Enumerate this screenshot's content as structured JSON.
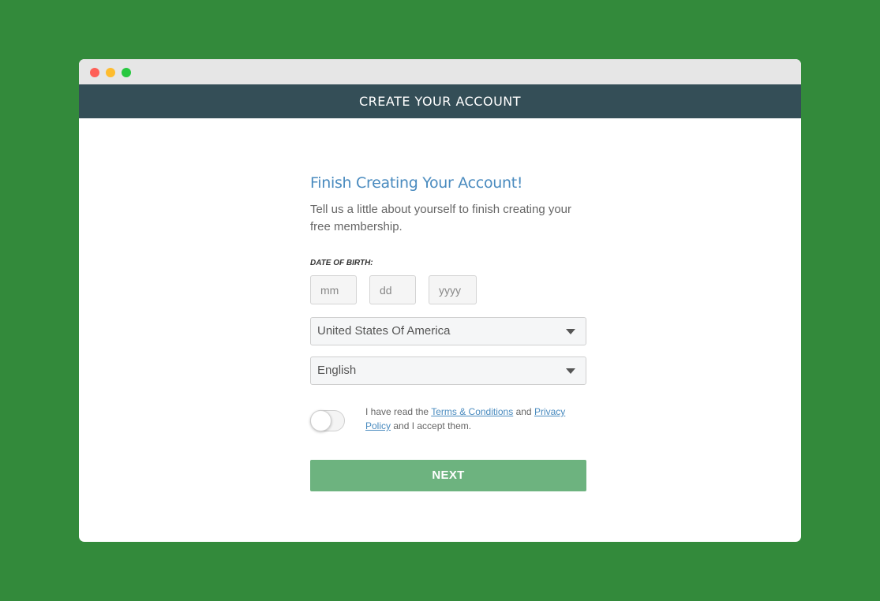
{
  "window": {
    "header_title": "CREATE YOUR ACCOUNT"
  },
  "form": {
    "headline": "Finish Creating Your Account!",
    "subtitle": "Tell us a little about yourself to finish creating your free membership.",
    "dob": {
      "label": "DATE OF BIRTH:",
      "month_placeholder": "mm",
      "day_placeholder": "dd",
      "year_placeholder": "yyyy"
    },
    "country_select": {
      "selected": "United States Of America"
    },
    "language_select": {
      "selected": "English"
    },
    "terms": {
      "checked": false,
      "prefix": "I have read the ",
      "terms_link": "Terms & Conditions",
      "middle": " and ",
      "privacy_link": "Privacy Policy",
      "suffix": " and I accept them."
    },
    "next_label": "NEXT"
  },
  "colors": {
    "background": "#338a3b",
    "header": "#344e57",
    "accent": "#4a8bbf",
    "button": "#6db37f"
  },
  "icons": [
    "chevron-down-icon"
  ]
}
